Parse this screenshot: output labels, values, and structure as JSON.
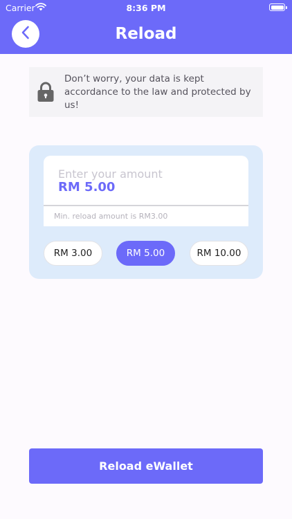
{
  "status_bar": {
    "carrier": "Carrier",
    "time": "8:36 PM"
  },
  "header": {
    "title": "Reload",
    "back_icon": "chevron-left-icon"
  },
  "notice": {
    "icon": "lock-icon",
    "text": "Don’t worry, your data is kept accordance to the law and protected by us!"
  },
  "amount": {
    "label": "Enter your amount",
    "value": "RM 5.00",
    "min_note": "Min. reload amount is RM3.00"
  },
  "chips": [
    {
      "label": "RM 3.00",
      "selected": false
    },
    {
      "label": "RM 5.00",
      "selected": true
    },
    {
      "label": "RM 10.00",
      "selected": false
    }
  ],
  "submit": {
    "label": "Reload eWallet"
  },
  "colors": {
    "accent": "#6C6AF9",
    "card_bg": "#DDEBFB",
    "page_bg": "#FDFAFE"
  }
}
